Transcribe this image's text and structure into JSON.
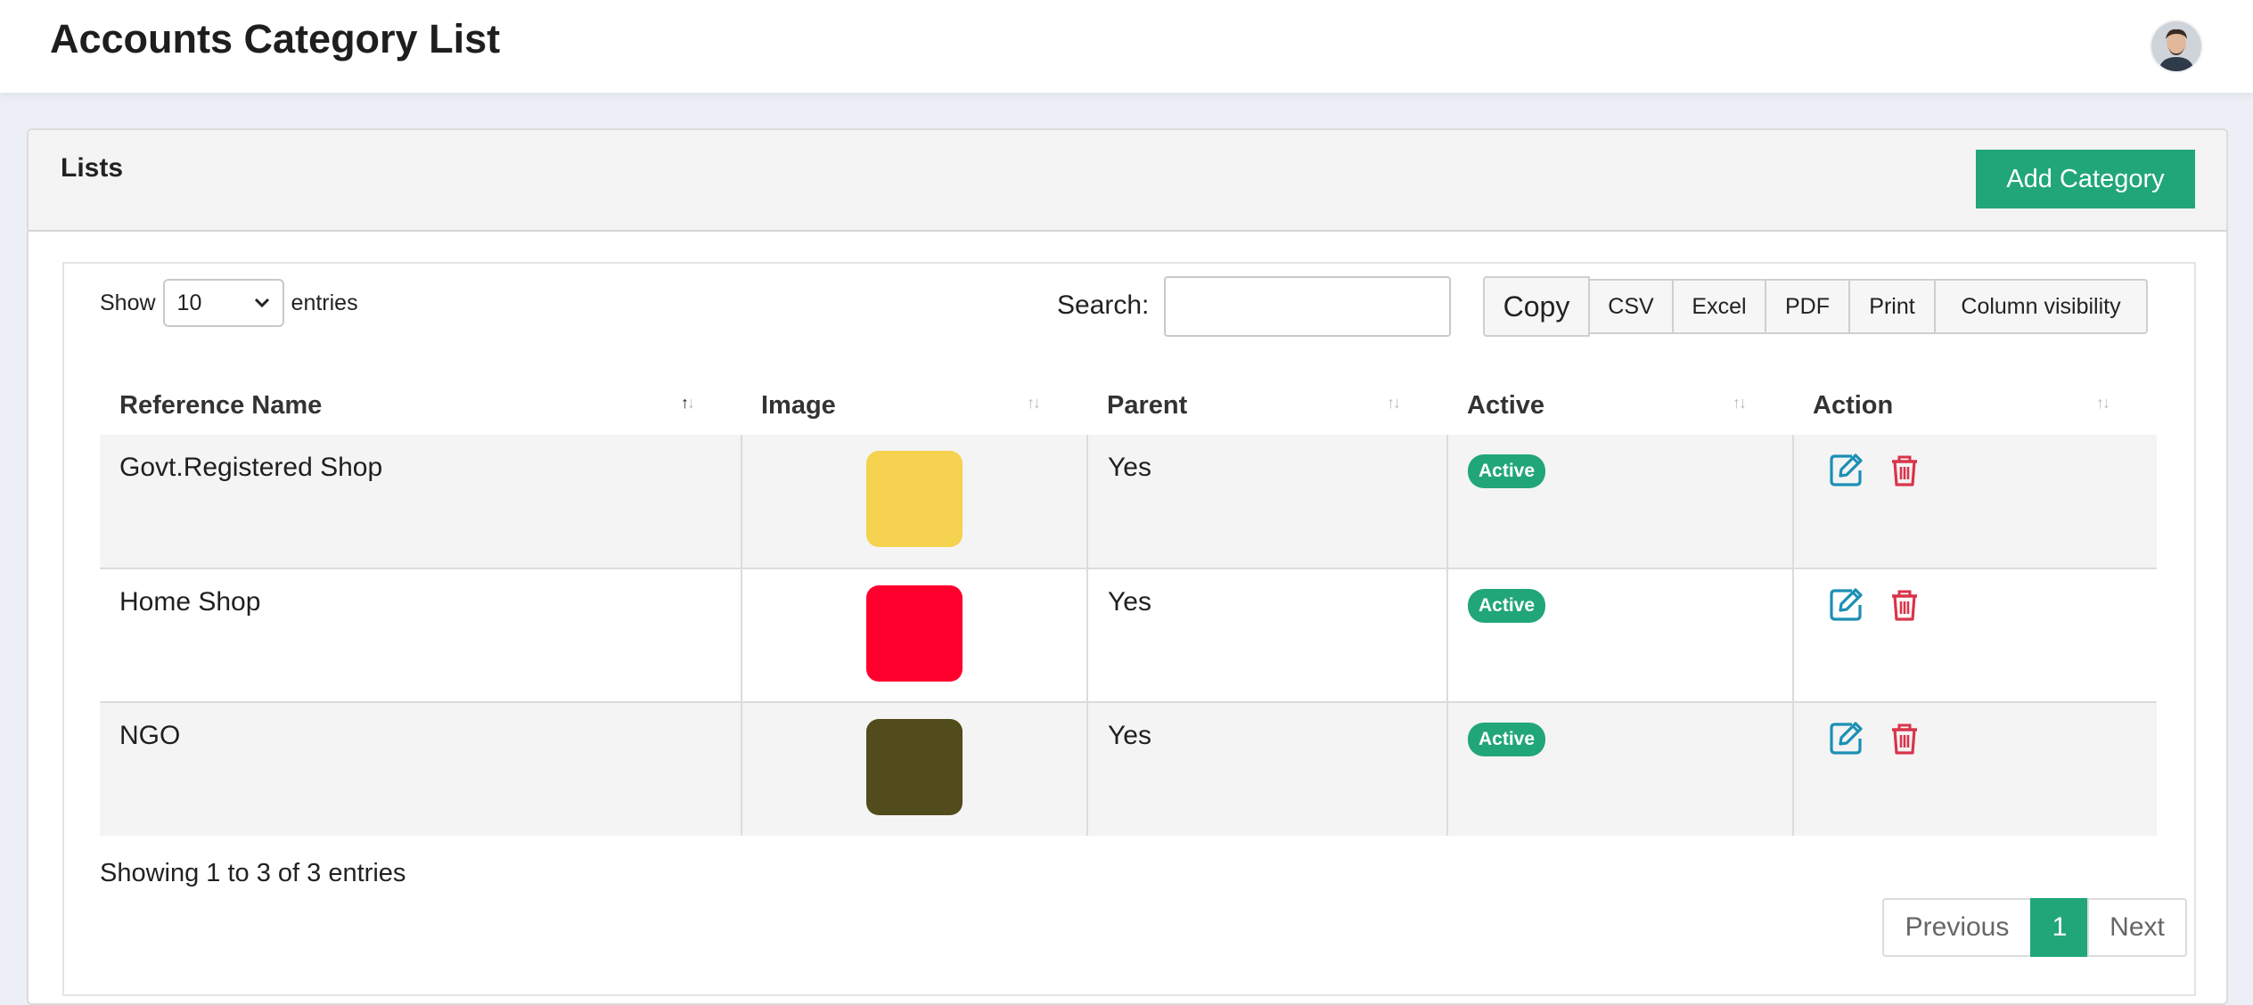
{
  "header": {
    "title": "Accounts Category List",
    "avatar_icon": "user-avatar"
  },
  "card": {
    "title": "Lists",
    "add_button": "Add Category"
  },
  "controls": {
    "show_label": "Show",
    "entries_value": "10",
    "entries_label": "entries",
    "search_label": "Search:",
    "search_value": "",
    "buttons": [
      "Copy",
      "CSV",
      "Excel",
      "PDF",
      "Print",
      "Column visibility"
    ]
  },
  "table": {
    "columns": [
      "Reference Name",
      "Image",
      "Parent",
      "Active",
      "Action"
    ],
    "rows": [
      {
        "name": "Govt.Registered Shop",
        "color": "#f5d24f",
        "parent": "Yes",
        "status": "Active"
      },
      {
        "name": "Home Shop",
        "color": "#ff002e",
        "parent": "Yes",
        "status": "Active"
      },
      {
        "name": "NGO",
        "color": "#524b1b",
        "parent": "Yes",
        "status": "Active"
      }
    ]
  },
  "footer": {
    "info": "Showing 1 to 3 of 3 entries",
    "prev": "Previous",
    "page": "1",
    "next": "Next"
  },
  "colors": {
    "accent": "#21a67a",
    "edit_icon": "#1c8fb5",
    "delete_icon": "#d9344a"
  }
}
